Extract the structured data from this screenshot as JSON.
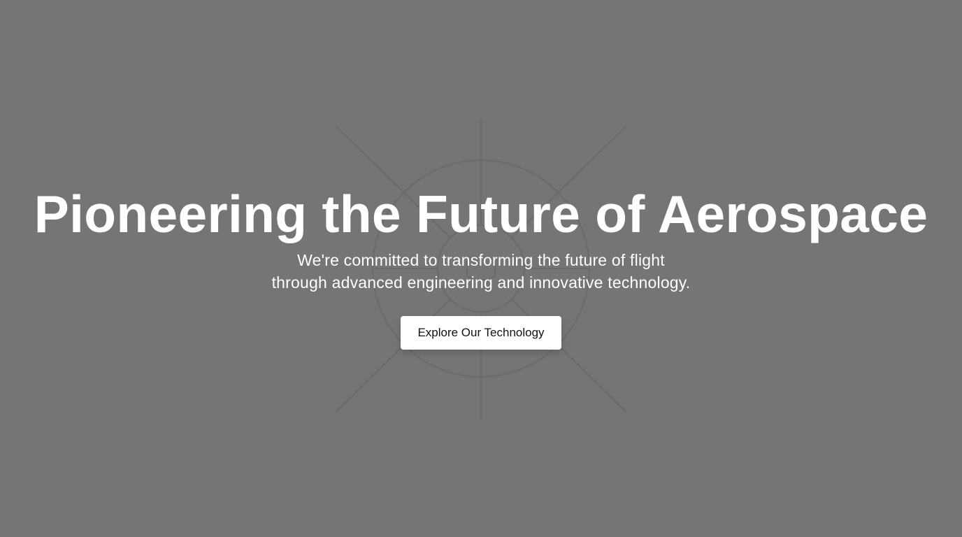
{
  "hero": {
    "title": "Pioneering the Future of Aerospace",
    "subtitle_line1": "We're committed to transforming the future of flight",
    "subtitle_line2": "through advanced engineering and innovative technology.",
    "cta_label": "Explore Our Technology"
  },
  "colors": {
    "background": "#757575",
    "text": "#ffffff",
    "button_background": "#ffffff",
    "button_text": "#111111",
    "graphic_stroke": "#6a6a6a"
  },
  "decor": {
    "background_graphic": "turbine-engine-icon"
  }
}
